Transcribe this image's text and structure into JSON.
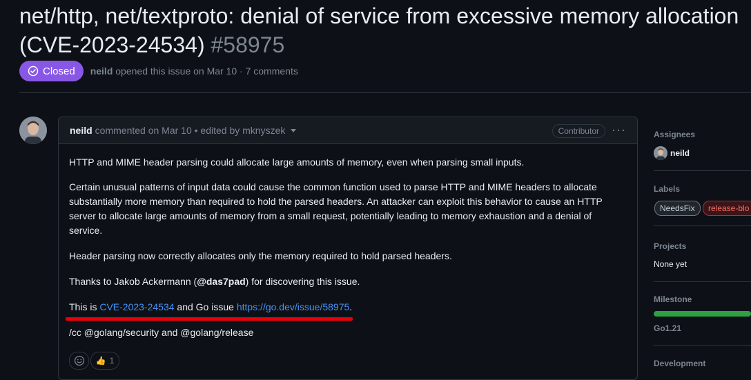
{
  "issue": {
    "title_line1": "net/http, net/textproto: denial of service from excessive memory allocation",
    "title_line2": "(CVE-2023-24534)",
    "number": "#58975",
    "status": "Closed",
    "author": "neild",
    "meta": "opened this issue on Mar 10 · 7 comments"
  },
  "comment": {
    "author": "neild",
    "meta": "commented on Mar 10 • edited by mknyszek",
    "role_badge": "Contributor",
    "menu_icon": "kebab-icon",
    "paragraphs": {
      "p1": "HTTP and MIME header parsing could allocate large amounts of memory, even when parsing small inputs.",
      "p2_l1": "Certain unusual patterns of input data could cause the common function used to parse HTTP and MIME headers to allocate",
      "p2_l2": "substantially more memory than required to hold the parsed headers. An attacker can exploit this behavior to cause an HTTP",
      "p2_l3": "server to allocate large amounts of memory from a small request, potentially leading to memory exhaustion and a denial of",
      "p2_l4": "service.",
      "p3": "Header parsing now correctly allocates only the memory required to hold parsed headers.",
      "p4_pre": "Thanks to Jakob Ackermann (",
      "p4_bold": "@das7pad",
      "p4_post": ") for discovering this issue.",
      "p5_pre": "This is ",
      "p5_link1": "CVE-2023-24534",
      "p5_mid": " and Go issue ",
      "p5_link2": "https://go.dev/issue/58975",
      "p5_post": ".",
      "p6": "/cc @golang/security and @golang/release"
    },
    "reactions": {
      "add_icon": "smiley-icon",
      "thumbs_icon": "thumbs-up-icon",
      "thumbs_count": "1"
    }
  },
  "sidebar": {
    "assignees_label": "Assignees",
    "assignee": "neild",
    "labels_label": "Labels",
    "labels": [
      "NeedsFix",
      "release-blo"
    ],
    "projects_label": "Projects",
    "projects_value": "None yet",
    "milestone_label": "Milestone",
    "milestone_value": "Go1.21",
    "milestone_progress": 1.0,
    "development_label": "Development"
  },
  "colors": {
    "closed_badge": "#8957e5",
    "link": "#4493f8",
    "annotation_underline": "#e8000a",
    "progress": "#2ea043"
  }
}
